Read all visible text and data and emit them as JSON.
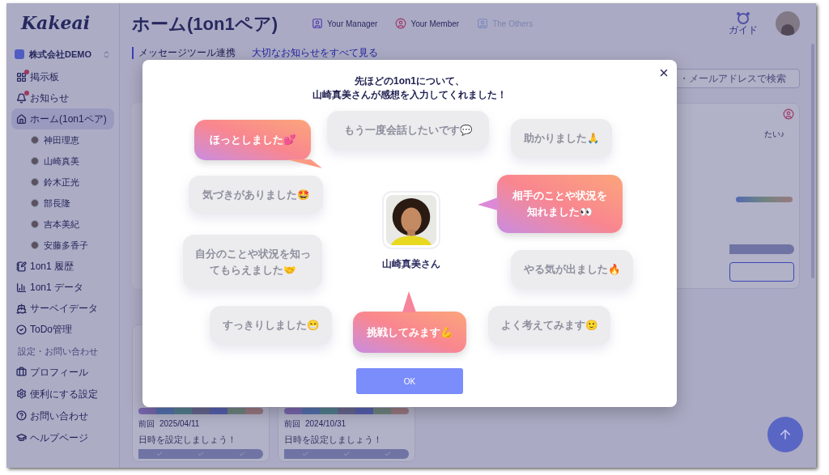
{
  "sidebar": {
    "logo": "Kakeai",
    "company": "株式会社DEMO",
    "items": [
      {
        "label": "掲示板",
        "badge": true,
        "selected": false,
        "expanded": false
      },
      {
        "label": "お知らせ",
        "badge": true,
        "selected": false,
        "expanded": false
      },
      {
        "label": "ホーム(1on1ペア)",
        "badge": false,
        "selected": true,
        "expanded": true,
        "children": [
          {
            "label": "神田理恵"
          },
          {
            "label": "山崎真美"
          },
          {
            "label": "鈴木正光"
          },
          {
            "label": "部長隆"
          },
          {
            "label": "吉本美紀"
          },
          {
            "label": "安藤多香子"
          }
        ]
      },
      {
        "label": "1on1 履歴",
        "badge": false,
        "selected": false,
        "expanded": false
      },
      {
        "label": "1on1 データ",
        "badge": false,
        "selected": false,
        "expanded": false
      },
      {
        "label": "サーベイデータ",
        "badge": false,
        "selected": false,
        "expanded": false
      },
      {
        "label": "ToDo管理",
        "badge": false,
        "selected": false,
        "expanded": false
      }
    ],
    "section_label": "設定・お問い合わせ",
    "settings_items": [
      {
        "label": "プロフィール"
      },
      {
        "label": "便利にする設定"
      },
      {
        "label": "お問い合わせ"
      },
      {
        "label": "ヘルプページ"
      }
    ]
  },
  "header": {
    "title": "ホーム(1on1ペア)",
    "roles": [
      {
        "label": "Your Manager",
        "kind": "manager",
        "enabled": true
      },
      {
        "label": "Your Member",
        "kind": "member",
        "enabled": true
      },
      {
        "label": "The Others",
        "kind": "others",
        "enabled": false
      }
    ],
    "guide": "ガイド"
  },
  "content": {
    "links": [
      "メッセージツール連携",
      "大切なお知らせをすべて見る"
    ],
    "search": {
      "placeholder": "・メールアドレスで検索"
    },
    "side_card": {
      "text": "たい♪"
    },
    "pair_cards": [
      {
        "last_label": "前回",
        "last_date": "2025/04/11",
        "hint": "日時を設定しましょう！"
      },
      {
        "last_label": "前回",
        "last_date": "2024/10/31",
        "hint": "日時を設定しましょう！"
      }
    ]
  },
  "modal": {
    "message": [
      "先ほどの1on1について、",
      "山崎真美さんが感想を入力してくれました！"
    ],
    "person": "山崎真美さん",
    "reactions": [
      {
        "label": "ほっとしました💕",
        "selected": true
      },
      {
        "label": "もう一度会話したいです💬",
        "selected": false
      },
      {
        "label": "助かりました🙏",
        "selected": false
      },
      {
        "label": "気づきがありました🤩",
        "selected": false
      },
      {
        "label": "相手のことや状況を知れました👀",
        "selected": true
      },
      {
        "label": "自分のことや状況を知ってもらえました🤝",
        "selected": false
      },
      {
        "label": "やる気が出ました🔥",
        "selected": false
      },
      {
        "label": "すっきりしました😁",
        "selected": false
      },
      {
        "label": "挑戦してみます💪",
        "selected": true
      },
      {
        "label": "よく考えてみます🙂",
        "selected": false
      }
    ],
    "ok": "OK"
  }
}
